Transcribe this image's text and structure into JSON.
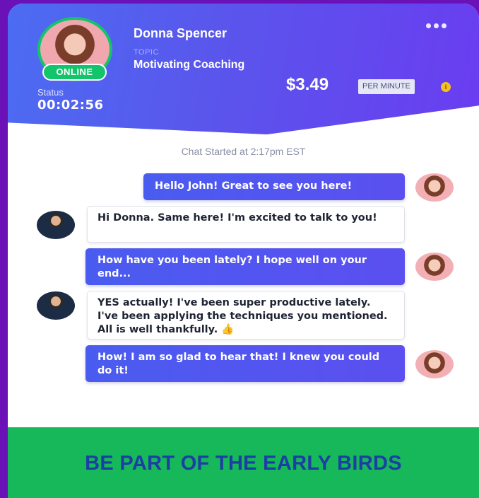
{
  "profile": {
    "name": "Donna Spencer",
    "topic_label": "TOPIC",
    "topic": "Motivating Coaching",
    "online_badge": "ONLINE",
    "status_label": "Status",
    "status_time": "00:02:56"
  },
  "pricing": {
    "price": "$3.49",
    "unit": "PER MINUTE",
    "info_icon": "i"
  },
  "chat": {
    "started": "Chat Started at 2:17pm EST",
    "messages": [
      {
        "from": "me",
        "text": "Hello John! Great to see you here!"
      },
      {
        "from": "them",
        "text": "Hi Donna. Same here! I'm excited to talk to you!"
      },
      {
        "from": "me",
        "text": "How have you been lately? I hope well on your end..."
      },
      {
        "from": "them",
        "text": "YES actually! I've been super productive lately. I've been applying the techniques you mentioned. All is well thankfully. 👍"
      },
      {
        "from": "me",
        "text": "How! I am so glad to hear that! I knew you could do it!"
      }
    ]
  },
  "footer": {
    "text": "BE PART OF THE EARLY BIRDS"
  },
  "colors": {
    "header_start": "#4c6cf2",
    "header_end": "#6a3df0",
    "online_green": "#14c46b",
    "footer_green": "#17b85a",
    "footer_text": "#1b3fa3",
    "page_bg": "#6a12b8"
  }
}
